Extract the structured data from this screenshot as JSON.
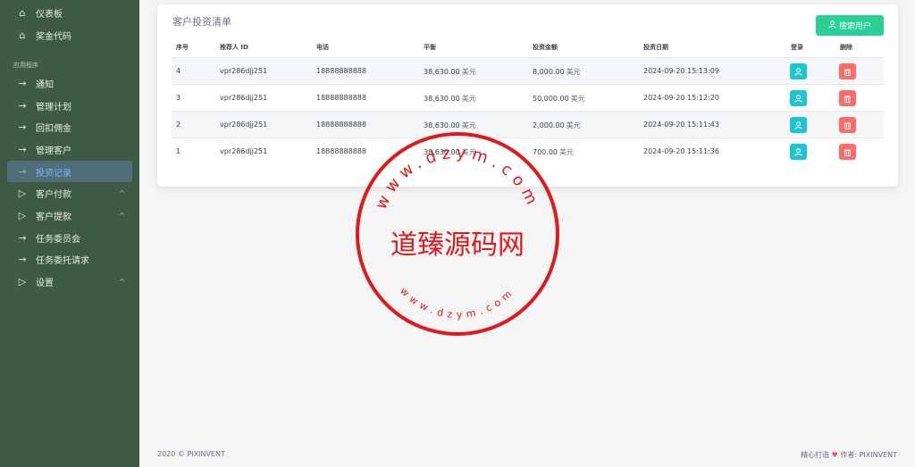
{
  "sidebar": {
    "top_items": [
      {
        "label": "仪表板",
        "icon": "home-icon"
      },
      {
        "label": "奖金代码",
        "icon": "home-icon"
      }
    ],
    "section_title": "应用程序",
    "items": [
      {
        "label": "通知",
        "icon": "arrow-right-icon"
      },
      {
        "label": "管理计划",
        "icon": "arrow-right-icon"
      },
      {
        "label": "回扣佣金",
        "icon": "arrow-right-icon"
      },
      {
        "label": "管理客户",
        "icon": "arrow-right-icon"
      },
      {
        "label": "投资记录",
        "icon": "arrow-right-icon",
        "active": true
      },
      {
        "label": "客户付款",
        "icon": "play-icon",
        "caret": "^"
      },
      {
        "label": "客户提款",
        "icon": "play-icon",
        "caret": "^"
      },
      {
        "label": "任务委员会",
        "icon": "arrow-right-icon"
      },
      {
        "label": "任务委托请求",
        "icon": "arrow-right-icon"
      },
      {
        "label": "设置",
        "icon": "play-icon",
        "caret": "^"
      }
    ]
  },
  "card": {
    "title": "客户投资清单",
    "search_label": "搜索用户"
  },
  "table": {
    "headers": [
      "序号",
      "推荐人 ID",
      "电话",
      "平衡",
      "投资金额",
      "投资日期",
      "登录",
      "删除"
    ],
    "rows": [
      {
        "no": "4",
        "ref": "vpr286djj251",
        "phone": "18888888888",
        "balance": "38,630.00",
        "amount": "8,000.00",
        "date": "2024-09-20 15:13:09"
      },
      {
        "no": "3",
        "ref": "vpr286djj251",
        "phone": "18888888888",
        "balance": "38,630.00",
        "amount": "50,000.00",
        "date": "2024-09-20 15:12:20"
      },
      {
        "no": "2",
        "ref": "vpr286djj251",
        "phone": "18888888888",
        "balance": "38,630.00",
        "amount": "2,000.00",
        "date": "2024-09-20 15:11:43"
      },
      {
        "no": "1",
        "ref": "vpr286djj251",
        "phone": "18888888888",
        "balance": "38,630.00",
        "amount": "700.00",
        "date": "2024-09-20 15:11:36"
      }
    ],
    "currency_unit": "美元"
  },
  "footer": {
    "copyright": "2020 © PIXINVENT",
    "made_with": "精心打造",
    "author_label": "作者:",
    "author": "PIXINVENT"
  },
  "watermark": {
    "center_text": "道臻源码网",
    "top_text": "www.dzym.com",
    "bottom_text": "www.dzym.com",
    "color": "#e0191c"
  }
}
